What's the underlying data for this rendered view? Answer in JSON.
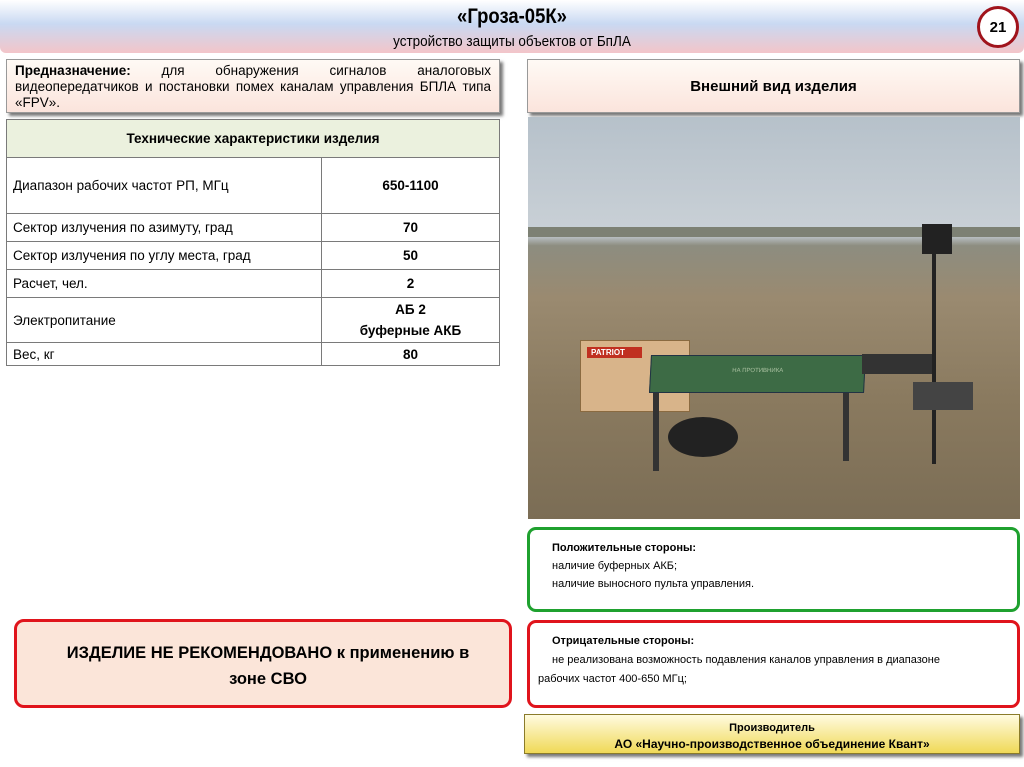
{
  "header": {
    "title": "«Гроза-05К»",
    "subtitle": "устройство защиты объектов от БпЛА",
    "page_number": "21"
  },
  "purpose": {
    "label": "Предназначение:",
    "text": " для обнаружения сигналов аналоговых видеопередатчиков и постановки помех каналам управления БПЛА типа «FPV»."
  },
  "specs": {
    "title": "Технические характеристики изделия",
    "rows": [
      {
        "name": "Диапазон рабочих частот РП, МГц",
        "value": "650-1100"
      },
      {
        "name": "Сектор излучения по азимуту, град",
        "value": "70"
      },
      {
        "name": "Сектор излучения по углу места, град",
        "value": "50"
      },
      {
        "name": "Расчет, чел.",
        "value": "2"
      },
      {
        "name": "Электропитание",
        "value": "АБ 2",
        "value2": "буферные АКБ"
      },
      {
        "name": "Вес, кг",
        "value": "80"
      }
    ]
  },
  "appearance": {
    "title": "Внешний вид изделия",
    "photo_labels": [
      "PATRIOT",
      "НА ПРОТИВНИКА"
    ]
  },
  "pros": {
    "title": "Положительные стороны:",
    "items": [
      "наличие буферных АКБ;",
      "наличие выносного пульта управления."
    ]
  },
  "cons": {
    "title": "Отрицательные стороны:",
    "line1": "не реализована возможность подавления каналов управления в диапазоне",
    "line2": "рабочих частот 400-650 МГц;"
  },
  "manufacturer": {
    "label": "Производитель",
    "name": "АО «Научно-производственное объединение Квант»"
  },
  "warning": {
    "text": "ИЗДЕЛИЕ НЕ РЕКОМЕНДОВАНО к применению в зоне СВО"
  },
  "colors": {
    "positive": "#1fa12f",
    "negative": "#e0141c",
    "badge": "#a0131c"
  }
}
